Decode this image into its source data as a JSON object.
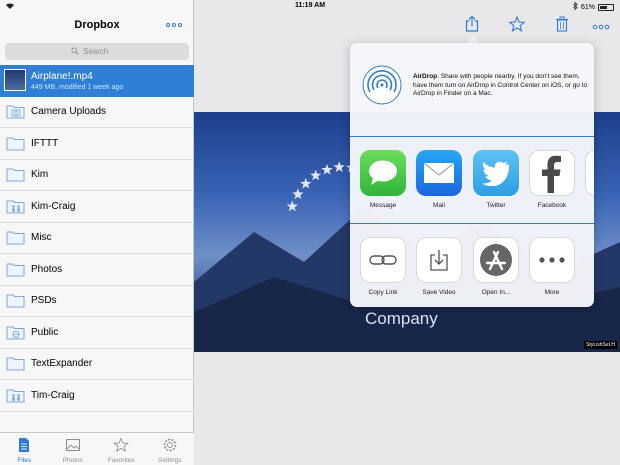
{
  "status": {
    "time": "11:19 AM",
    "battery": "61%",
    "battery_level": 0.61
  },
  "sidebar": {
    "title": "Dropbox",
    "search_placeholder": "Search",
    "files": [
      {
        "name": "Airplane!.mp4",
        "meta": "449 MB, modified 1 week ago",
        "icon": "video-thumbnail",
        "selected": true
      },
      {
        "name": "Camera Uploads",
        "icon": "camera-folder-icon"
      },
      {
        "name": "IFTTT",
        "icon": "folder-icon"
      },
      {
        "name": "Kim",
        "icon": "folder-icon"
      },
      {
        "name": "Kim-Craig",
        "icon": "shared-folder-icon"
      },
      {
        "name": "Misc",
        "icon": "folder-icon"
      },
      {
        "name": "Photos",
        "icon": "folder-icon"
      },
      {
        "name": "PSDs",
        "icon": "folder-icon"
      },
      {
        "name": "Public",
        "icon": "public-folder-icon"
      },
      {
        "name": "TextExpander",
        "icon": "folder-icon"
      },
      {
        "name": "Tim-Craig",
        "icon": "shared-folder-icon"
      }
    ],
    "tabs": [
      {
        "label": "Files",
        "icon": "files-icon",
        "active": true
      },
      {
        "label": "Photos",
        "icon": "photos-icon"
      },
      {
        "label": "Favorites",
        "icon": "star-icon"
      },
      {
        "label": "Settings",
        "icon": "gear-icon"
      }
    ]
  },
  "video": {
    "caption": "Company",
    "watermark": "StyLishSeLH"
  },
  "share": {
    "airdrop_title": "AirDrop",
    "airdrop_text": ". Share with people nearby. If you don't see them, have them turn on AirDrop in Control Center on iOS, or go to AirDrop in Finder on a Mac.",
    "apps": [
      {
        "label": "Message",
        "icon": "message-icon"
      },
      {
        "label": "Mail",
        "icon": "mail-icon"
      },
      {
        "label": "Twitter",
        "icon": "twitter-icon"
      },
      {
        "label": "Facebook",
        "icon": "facebook-icon"
      }
    ],
    "actions": [
      {
        "label": "Copy Link",
        "icon": "link-icon"
      },
      {
        "label": "Save Video",
        "icon": "save-icon"
      },
      {
        "label": "Open In...",
        "icon": "app-store-icon"
      },
      {
        "label": "More",
        "icon": "more-icon"
      }
    ]
  },
  "colors": {
    "accent": "#2e7bd6",
    "selected_row": "#2f7fd6"
  }
}
